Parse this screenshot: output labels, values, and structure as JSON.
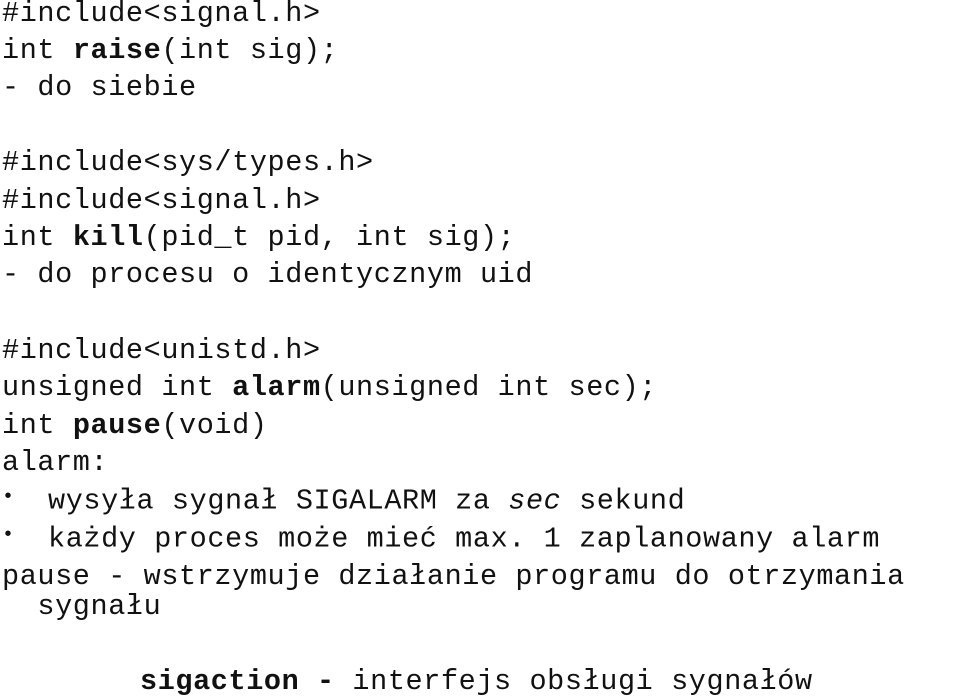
{
  "section_raise": {
    "include": "#include<signal.h>",
    "sig_prefix": "int ",
    "sig_name": "raise",
    "sig_suffix": "(int sig);",
    "note": "- do siebie"
  },
  "section_kill": {
    "include_1": "#include<sys/types.h>",
    "include_2": "#include<signal.h>",
    "sig_prefix": "int ",
    "sig_name": "kill",
    "sig_suffix": "(pid_t pid, int sig);",
    "note": "- do procesu o identycznym uid"
  },
  "section_alarm": {
    "include": "#include<unistd.h>",
    "alarm_prefix": "unsigned int ",
    "alarm_name": "alarm",
    "alarm_suffix": "(unsigned int sec);",
    "pause_prefix": "int ",
    "pause_name": "pause",
    "pause_suffix": "(void)",
    "alarm_heading": "alarm:",
    "bullets": [
      {
        "glyph": "•",
        "text_before": "wysyła sygnał SIGALARM za ",
        "text_italic": "sec",
        "text_after": " sekund"
      },
      {
        "glyph": "•",
        "text": "każdy proces może mieć max. 1 zaplanowany alarm"
      }
    ],
    "pause_desc_line1": "pause - wstrzymuje działanie programu do otrzymania",
    "pause_desc_line2": "  sygnału"
  },
  "footer": {
    "bold": "sigaction -",
    "text": " interfejs obsługi sygnałów"
  }
}
